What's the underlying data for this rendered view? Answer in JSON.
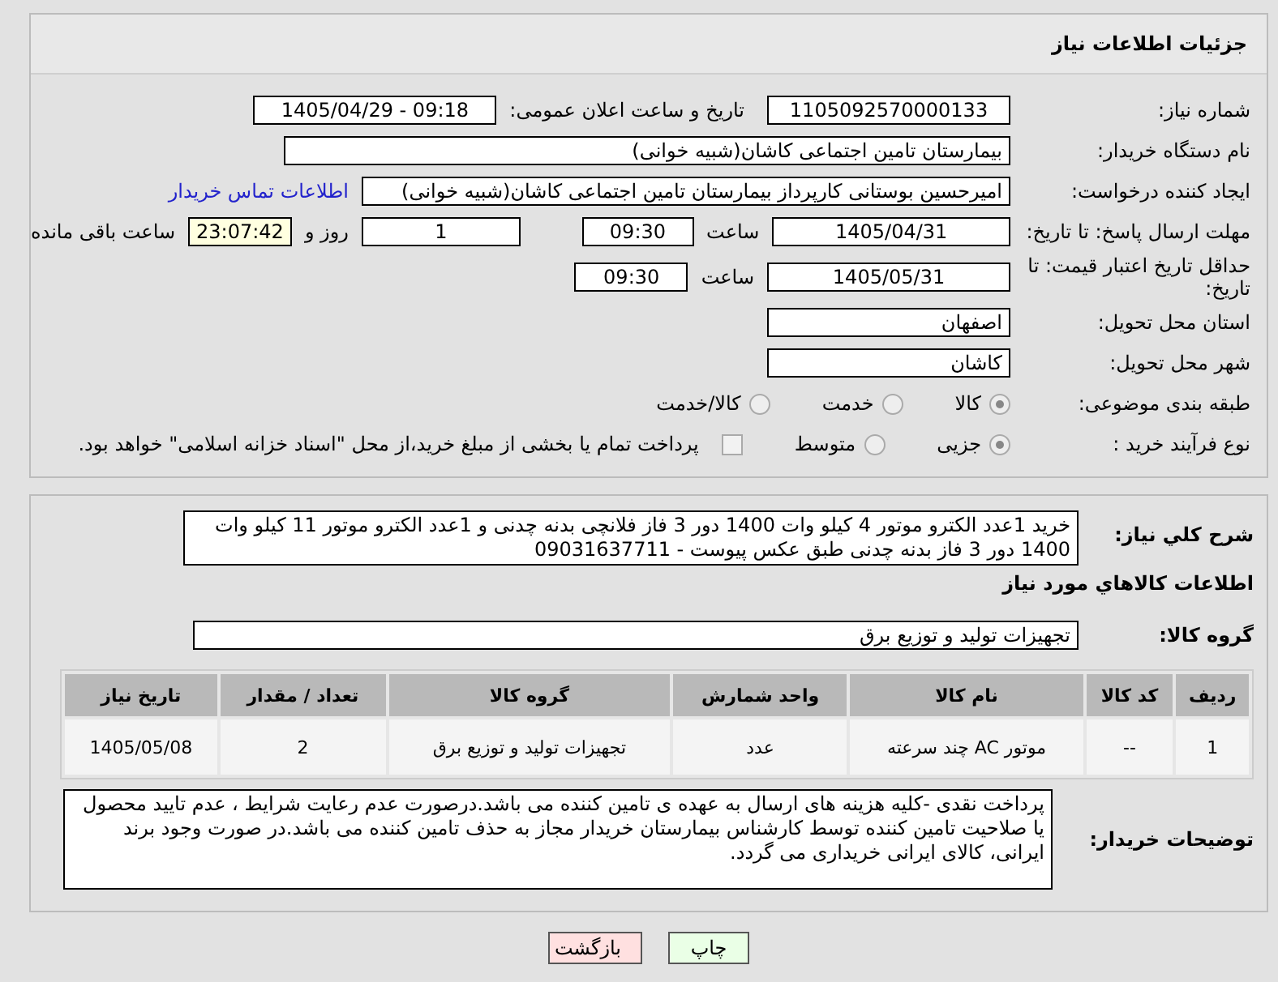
{
  "header": {
    "title": "جزئیات اطلاعات نیاز"
  },
  "need_number": {
    "label": "شماره نیاز:",
    "value": "1105092570000133"
  },
  "announce": {
    "label": "تاریخ و ساعت اعلان عمومی:",
    "value": "1405/04/29 - 09:18"
  },
  "buyer_org": {
    "label": "نام دستگاه خریدار:",
    "value": "بیمارستان تامین اجتماعی کاشان(شبیه خوانی)"
  },
  "creator": {
    "label": "ایجاد کننده درخواست:",
    "value": "امیرحسین بوستانی کارپرداز بیمارستان تامین اجتماعی کاشان(شبیه خوانی)",
    "link": "اطلاعات تماس خریدار"
  },
  "reply_deadline": {
    "label": "مهلت ارسال پاسخ: تا تاریخ:",
    "date": "1405/04/31",
    "time_label": "ساعت",
    "time": "09:30",
    "days": "1",
    "days_label": "روز و",
    "remaining": "23:07:42",
    "remaining_label": "ساعت باقی مانده"
  },
  "price_validity": {
    "label": "حداقل تاریخ اعتبار قیمت: تا تاریخ:",
    "date": "1405/05/31",
    "time_label": "ساعت",
    "time": "09:30"
  },
  "province": {
    "label": "استان محل تحویل:",
    "value": "اصفهان"
  },
  "city": {
    "label": "شهر محل تحویل:",
    "value": "کاشان"
  },
  "category": {
    "label": "طبقه بندی موضوعی:",
    "options": [
      {
        "label": "کالا",
        "selected": true
      },
      {
        "label": "خدمت",
        "selected": false
      },
      {
        "label": "کالا/خدمت",
        "selected": false
      }
    ]
  },
  "process": {
    "label": "نوع فرآیند خرید :",
    "options": [
      {
        "label": "جزیی",
        "selected": true
      },
      {
        "label": "متوسط",
        "selected": false
      }
    ],
    "treasury": {
      "checked": false,
      "label": "پرداخت تمام یا بخشی از مبلغ خرید،از محل \"اسناد خزانه اسلامی\" خواهد بود."
    }
  },
  "description": {
    "label": "شرح کلي نياز:",
    "value": "خريد 1عدد الکترو موتور 4 کیلو وات 1400 دور 3 فاز فلانچی بدنه چدنی و 1عدد الکترو موتور 11 کیلو وات 1400 دور 3 فاز بدنه چدنی طبق عکس پیوست - 09031637711"
  },
  "goods_title": "اطلاعات کالاهاي مورد نياز",
  "goods_group": {
    "label": "گروه کالا:",
    "value": "تجهیزات تولید و توزیع برق"
  },
  "table": {
    "columns": [
      "ردیف",
      "کد کالا",
      "نام کالا",
      "واحد شمارش",
      "گروه کالا",
      "تعداد / مقدار",
      "تاریخ نیاز"
    ],
    "rows": [
      [
        "1",
        "--",
        "موتور AC چند سرعته",
        "عدد",
        "تجهیزات تولید و توزیع برق",
        "2",
        "1405/05/08"
      ]
    ]
  },
  "buyer_notes": {
    "label": "توضیحات خریدار:",
    "value": "پرداخت نقدی -کلیه هزینه های ارسال به عهده ی تامین کننده می باشد.درصورت عدم رعایت شرایط ، عدم تایید محصول یا صلاحیت تامین کننده توسط کارشناس بیمارستان خریدار مجاز به حذف تامین کننده می باشد.در صورت وجود برند ایرانی، کالای ایرانی خریداری می گردد."
  },
  "buttons": [
    {
      "label": "چاپ",
      "kind": "print"
    },
    {
      "label": "بازگشت",
      "kind": "back"
    }
  ]
}
